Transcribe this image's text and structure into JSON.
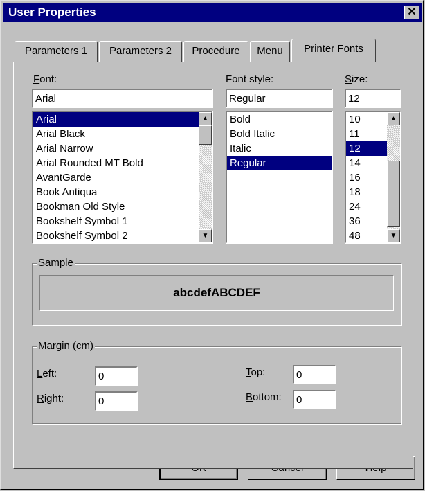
{
  "window": {
    "title": "User Properties",
    "close_glyph": "✕"
  },
  "tabs": [
    "Parameters 1",
    "Parameters 2",
    "Procedure",
    "Menu",
    "Printer Fonts"
  ],
  "font": {
    "label_prefix": "",
    "label_mnemonic": "F",
    "label_rest": "ont:",
    "value": "Arial",
    "items": [
      "Arial",
      "Arial Black",
      "Arial Narrow",
      "Arial Rounded MT Bold",
      "AvantGarde",
      "Book Antiqua",
      "Bookman Old Style",
      "Bookshelf Symbol 1",
      "Bookshelf Symbol 2"
    ],
    "selected": "Arial"
  },
  "style": {
    "label": "Font style:",
    "value": "Regular",
    "items": [
      "Bold",
      "Bold Italic",
      "Italic",
      "Regular"
    ],
    "selected": "Regular"
  },
  "size": {
    "label_mnemonic": "S",
    "label_rest": "ize:",
    "value": "12",
    "items": [
      "10",
      "11",
      "12",
      "14",
      "16",
      "18",
      "24",
      "36",
      "48"
    ],
    "selected": "12"
  },
  "sample": {
    "title": "Sample",
    "text": "abcdefABCDEF"
  },
  "margin": {
    "title": "Margin (cm)",
    "left_mnemonic": "L",
    "left_rest": "eft:",
    "left_value": "0",
    "right_mnemonic": "R",
    "right_rest": "ight:",
    "right_value": "0",
    "top_mnemonic": "T",
    "top_rest": "op:",
    "top_value": "0",
    "bottom_mnemonic": "B",
    "bottom_rest": "ottom:",
    "bottom_value": "0"
  },
  "buttons": {
    "ok": "OK",
    "cancel": "Cancel",
    "help": "Help"
  },
  "icons": {
    "scroll_up": "▲",
    "scroll_down": "▼"
  },
  "colors": {
    "selection": "#000080",
    "titlebar": "#000080",
    "face": "#c0c0c0"
  }
}
